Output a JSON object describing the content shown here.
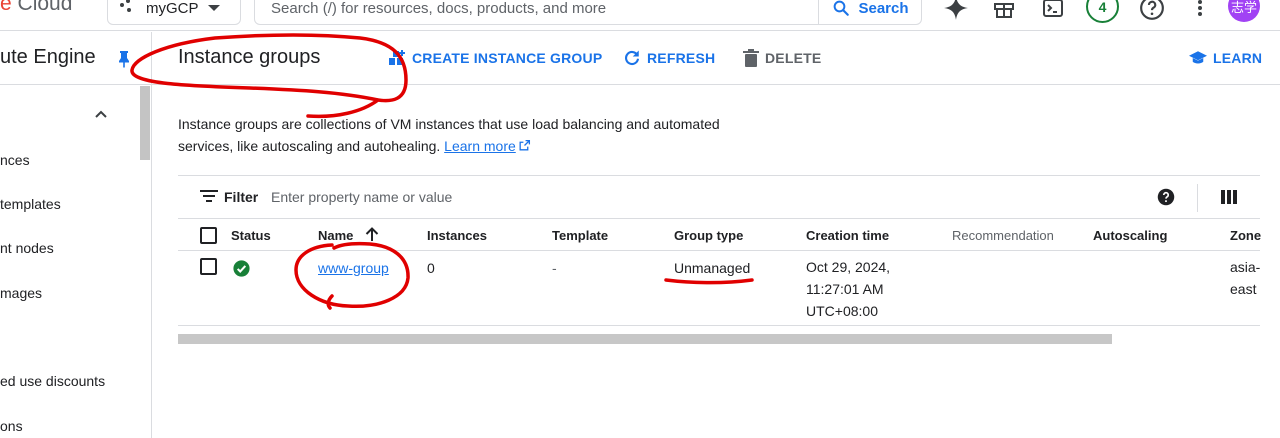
{
  "topbar": {
    "brand_prefix": "e",
    "brand_suffix": " Cloud",
    "project_label": "myGCP",
    "search_placeholder": "Search (/) for resources, docs, products, and more",
    "search_button_label": "Search",
    "notification_count": "4",
    "avatar_text": "志学"
  },
  "sidenav": {
    "product_title": "ute Engine",
    "items": [
      {
        "label": "nces"
      },
      {
        "label": "templates"
      },
      {
        "label": "nt nodes"
      },
      {
        "label": "mages"
      },
      {
        "label": "ed use discounts"
      },
      {
        "label": "ons"
      }
    ]
  },
  "header": {
    "title": "Instance groups",
    "create_label": "CREATE INSTANCE GROUP",
    "refresh_label": "REFRESH",
    "delete_label": "DELETE",
    "learn_label": "LEARN"
  },
  "description": {
    "line1": "Instance groups are collections of VM instances that use load balancing and automated",
    "line2": "services, like autoscaling and autohealing.",
    "learn_more": "Learn more"
  },
  "filter": {
    "label": "Filter",
    "placeholder": "Enter property name or value"
  },
  "table": {
    "headers": {
      "status": "Status",
      "name": "Name",
      "instances": "Instances",
      "template": "Template",
      "group_type": "Group type",
      "creation_time": "Creation time",
      "recommendation": "Recommendation",
      "autoscaling": "Autoscaling",
      "zone": "Zone"
    },
    "rows": [
      {
        "status": "ok",
        "name": "www-group",
        "instances": "0",
        "template": "-",
        "group_type": "Unmanaged",
        "creation_time_1": "Oct 29, 2024,",
        "creation_time_2": "11:27:01 AM",
        "creation_time_3": "UTC+08:00",
        "zone_1": "asia-",
        "zone_2": "east"
      }
    ]
  },
  "colors": {
    "accent": "#1a73e8",
    "success": "#188038",
    "annotation": "#e00000"
  }
}
